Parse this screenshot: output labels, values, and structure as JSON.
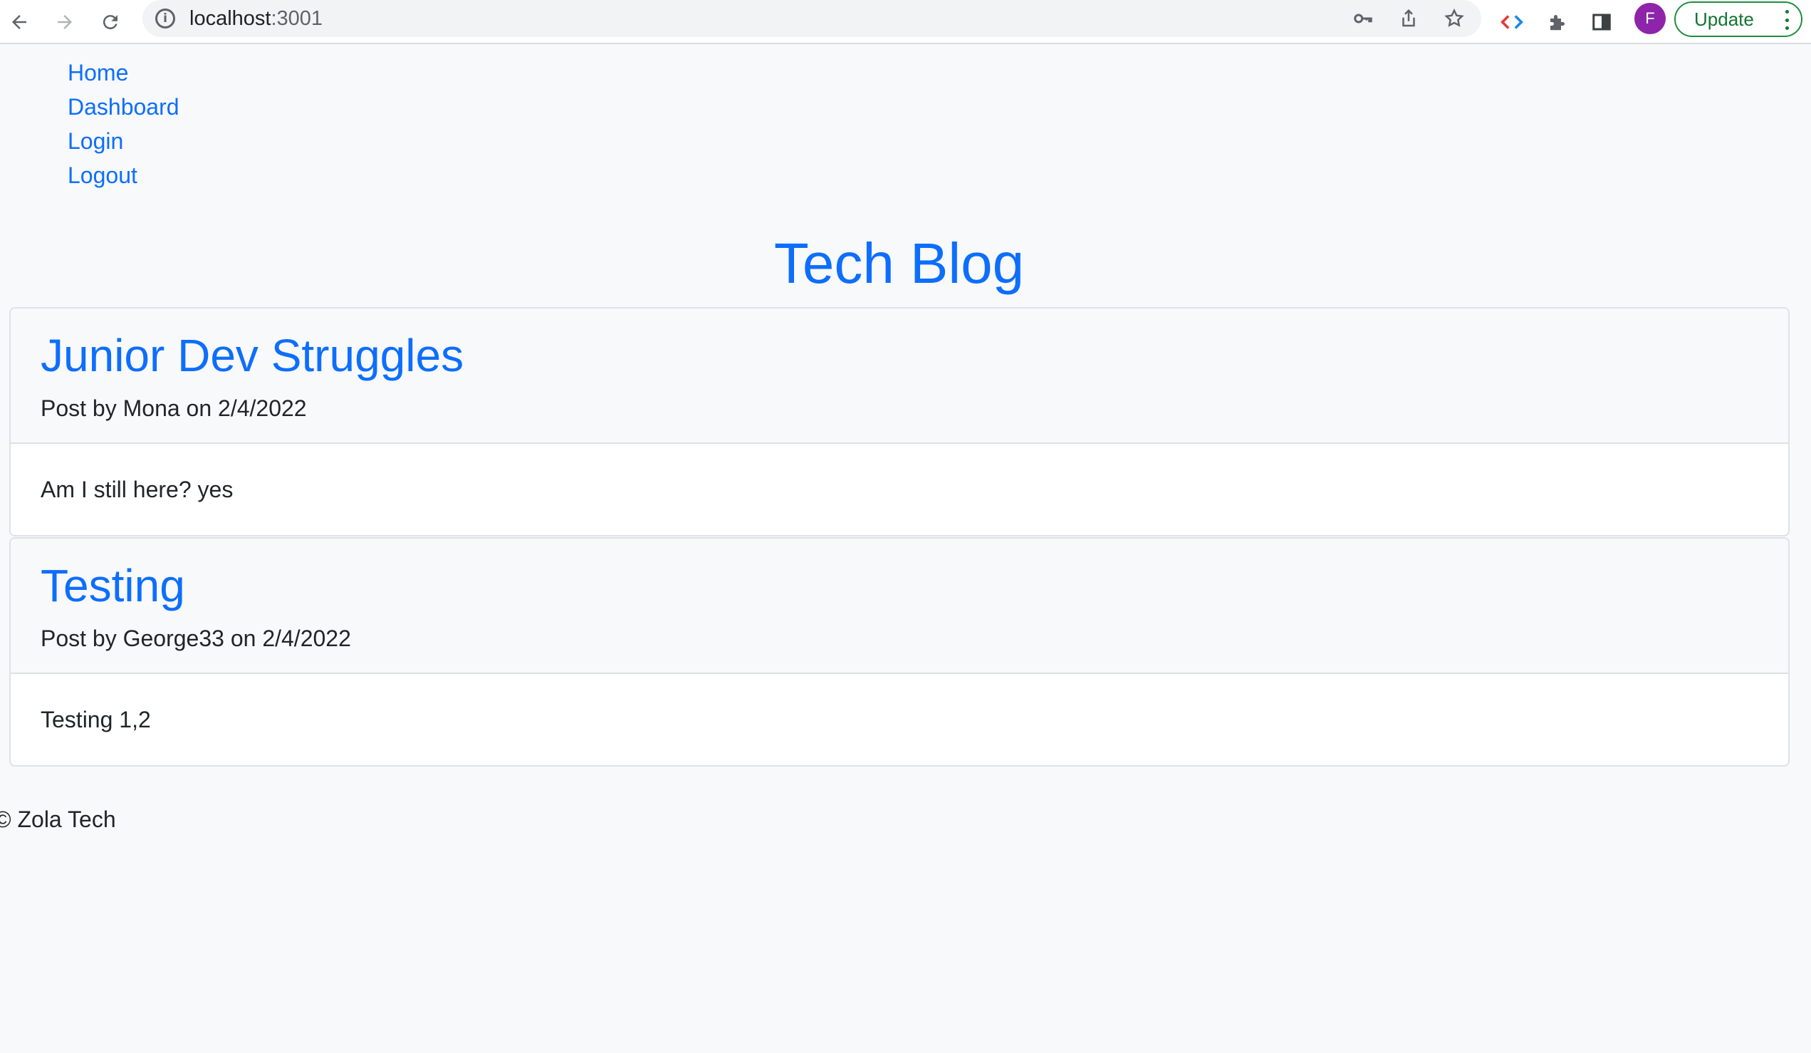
{
  "browser": {
    "url_host": "localhost",
    "url_port": ":3001",
    "info_icon": "i",
    "profile_initial": "F",
    "update_label": "Update",
    "icons": [
      "back-arrow-icon",
      "forward-arrow-icon",
      "reload-icon",
      "info-icon",
      "key-icon",
      "share-icon",
      "star-icon",
      "code-brackets-icon",
      "puzzle-piece-icon",
      "side-panel-icon",
      "more-vertical-icon"
    ]
  },
  "nav": {
    "items": [
      {
        "label": "Home"
      },
      {
        "label": "Dashboard"
      },
      {
        "label": "Login"
      },
      {
        "label": "Logout"
      }
    ]
  },
  "site_title": "Tech Blog",
  "posts": [
    {
      "title": "Junior Dev Struggles",
      "meta": "Post by Mona on 2/4/2022",
      "body": "Am I still here? yes"
    },
    {
      "title": "Testing",
      "meta": "Post by George33 on 2/4/2022",
      "body": "Testing 1,2"
    }
  ],
  "footer": {
    "text": "© Zola Tech"
  },
  "colors": {
    "link": "#0d6efd",
    "page_bg": "#f8f9fa",
    "border": "#dee2e6",
    "avatar": "#8e24aa",
    "update_green": "#137333"
  }
}
